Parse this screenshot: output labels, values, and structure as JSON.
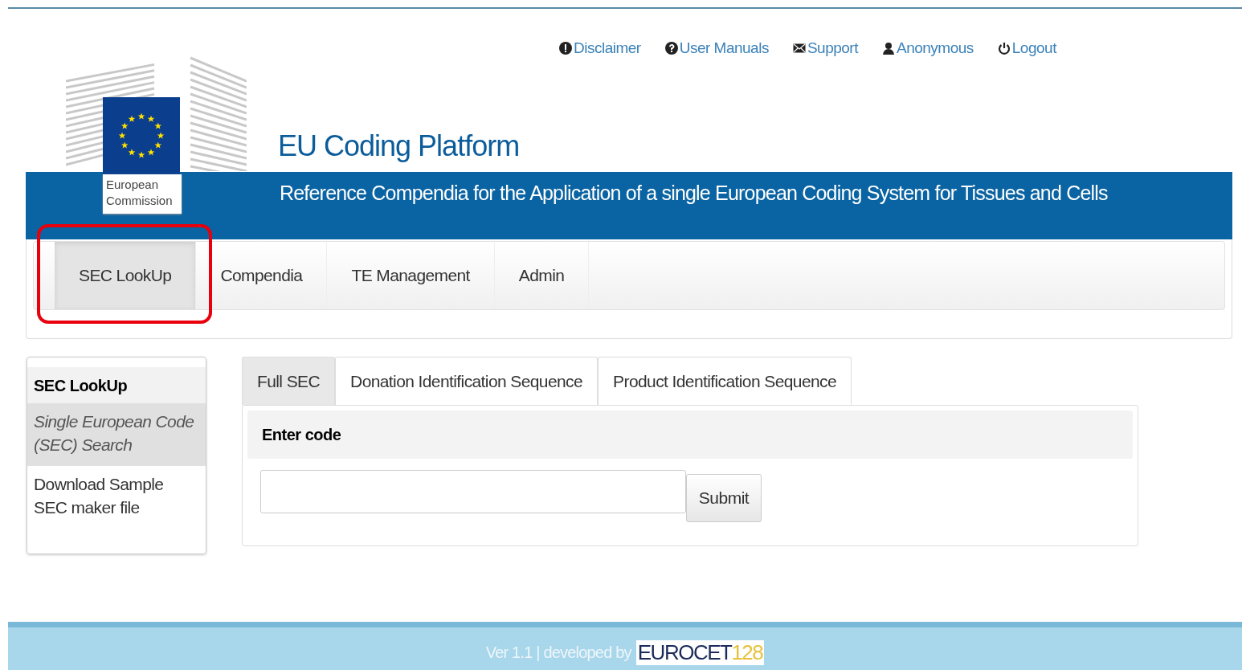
{
  "top_links": [
    {
      "kind": "alert",
      "label": "Disclaimer"
    },
    {
      "kind": "help",
      "label": "User Manuals"
    },
    {
      "kind": "mail",
      "label": "Support"
    },
    {
      "kind": "user",
      "label": "Anonymous"
    },
    {
      "kind": "power",
      "label": "Logout"
    }
  ],
  "logo": {
    "line1": "European",
    "line2": "Commission"
  },
  "site_title": "EU Coding Platform",
  "banner_text": "Reference Compendia for the Application of a single European Coding System for Tissues and Cells",
  "nav": [
    {
      "label": "SEC LookUp",
      "selected": true,
      "highlighted": true
    },
    {
      "label": "Compendia",
      "selected": false,
      "highlighted": false
    },
    {
      "label": "TE Management",
      "selected": false,
      "highlighted": false
    },
    {
      "label": "Admin",
      "selected": false,
      "highlighted": false
    }
  ],
  "sidebar": {
    "title": "SEC LookUp",
    "items": [
      {
        "label": "Single European Code (SEC) Search",
        "selected": true
      },
      {
        "label": "Download Sample SEC maker file",
        "selected": false
      }
    ]
  },
  "tabs": [
    {
      "label": "Full SEC",
      "selected": true
    },
    {
      "label": "Donation Identification Sequence",
      "selected": false
    },
    {
      "label": "Product Identification Sequence",
      "selected": false
    }
  ],
  "form": {
    "heading": "Enter code",
    "submit": "Submit"
  },
  "footer": {
    "text": "Ver 1.1 | developed by",
    "brand": "EUROCET",
    "brand_suffix": "128"
  }
}
